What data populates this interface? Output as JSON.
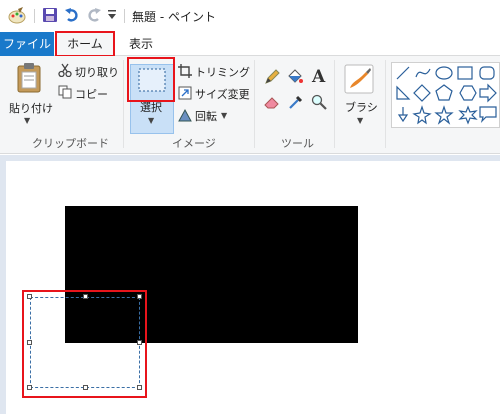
{
  "window": {
    "title": "無題 - ペイント"
  },
  "quick_access": {
    "save_icon": "save-icon",
    "undo_icon": "undo-icon",
    "redo_icon": "redo-icon",
    "customize_icon": "chevron-down-icon"
  },
  "tabs": {
    "file": "ファイル",
    "home": "ホーム",
    "view": "表示"
  },
  "clipboard": {
    "paste": "貼り付け",
    "cut": "切り取り",
    "copy": "コピー",
    "label": "クリップボード"
  },
  "image": {
    "select": "選択",
    "crop": "トリミング",
    "resize": "サイズ変更",
    "rotate": "回転",
    "label": "イメージ"
  },
  "tools": {
    "label": "ツール"
  },
  "brushes": {
    "label": "ブラシ"
  },
  "colors": {
    "accent": "#1979ca",
    "highlight": "#e8141b",
    "canvas_shape": "#000000"
  }
}
